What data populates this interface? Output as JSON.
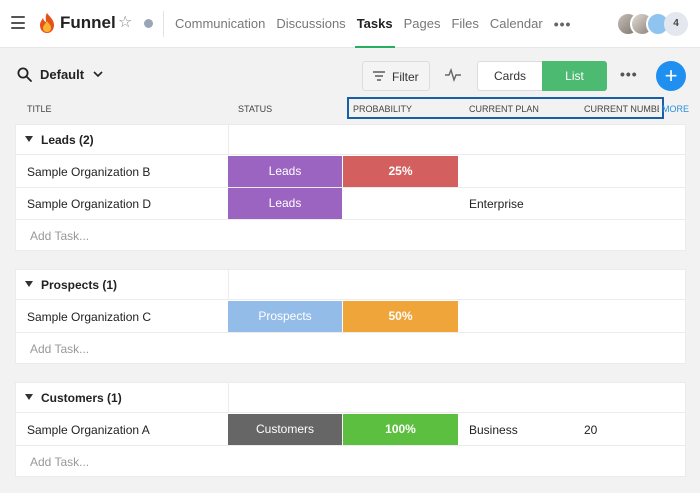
{
  "app": {
    "title": "Funnel",
    "brand_color": "#f39c12"
  },
  "nav": {
    "tabs": [
      {
        "label": "Communication",
        "active": false
      },
      {
        "label": "Discussions",
        "active": false
      },
      {
        "label": "Tasks",
        "active": true
      },
      {
        "label": "Pages",
        "active": false
      },
      {
        "label": "Files",
        "active": false
      },
      {
        "label": "Calendar",
        "active": false
      }
    ],
    "more_label": "•••",
    "members_count": "4"
  },
  "toolbar": {
    "view_name": "Default",
    "filter_label": "Filter",
    "cards_label": "Cards",
    "list_label": "List",
    "more_label": "•••",
    "add_label": "+"
  },
  "columns": {
    "title": "Title",
    "status": "Status",
    "probability": "Probability",
    "current_plan": "Current Plan",
    "current_number": "Current Number",
    "more": "More"
  },
  "groups": [
    {
      "title": "Leads (2)",
      "rows": [
        {
          "title": "Sample Organization B",
          "status": "Leads",
          "status_color": "#9b64c0",
          "probability": "25%",
          "probability_color": "#d45f5f",
          "plan": "",
          "number": ""
        },
        {
          "title": "Sample Organization D",
          "status": "Leads",
          "status_color": "#9b64c0",
          "probability": "",
          "probability_color": "",
          "plan": "Enterprise",
          "number": ""
        }
      ],
      "add_label": "Add Task..."
    },
    {
      "title": "Prospects (1)",
      "rows": [
        {
          "title": "Sample Organization C",
          "status": "Prospects",
          "status_color": "#94bce8",
          "probability": "50%",
          "probability_color": "#f0a53a",
          "plan": "",
          "number": ""
        }
      ],
      "add_label": "Add Task..."
    },
    {
      "title": "Customers (1)",
      "rows": [
        {
          "title": "Sample Organization A",
          "status": "Customers",
          "status_color": "#666666",
          "probability": "100%",
          "probability_color": "#5dbf3f",
          "plan": "Business",
          "number": "20"
        }
      ],
      "add_label": "Add Task..."
    }
  ]
}
